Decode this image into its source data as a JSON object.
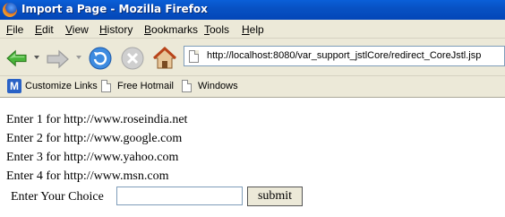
{
  "window": {
    "title": "Import a Page - Mozilla Firefox"
  },
  "menu": {
    "items": [
      "File",
      "Edit",
      "View",
      "History",
      "Bookmarks",
      "Tools",
      "Help"
    ]
  },
  "navigation": {
    "url": "http://localhost:8080/var_support_jstlCore/redirect_CoreJstl.jsp",
    "icons": [
      "back-icon",
      "forward-icon",
      "reload-icon",
      "stop-icon",
      "home-icon",
      "page-icon"
    ]
  },
  "bookmarks": {
    "items": [
      {
        "label": "Customize Links",
        "icon": "m-icon"
      },
      {
        "label": "Free Hotmail",
        "icon": "page-icon"
      },
      {
        "label": "Windows",
        "icon": "page-icon"
      }
    ]
  },
  "page": {
    "lines": [
      "Enter 1 for http://www.roseindia.net",
      "Enter 2 for http://www.google.com",
      "Enter 3 for http://www.yahoo.com",
      "Enter 4 for http://www.msn.com"
    ],
    "choice_label": "Enter Your Choice",
    "choice_value": "",
    "submit_label": "submit"
  },
  "colors": {
    "titlebar": "#0852c4",
    "chrome": "#ece9d8",
    "back_green": "#3fae2a",
    "reload_blue": "#2b7fd6"
  }
}
